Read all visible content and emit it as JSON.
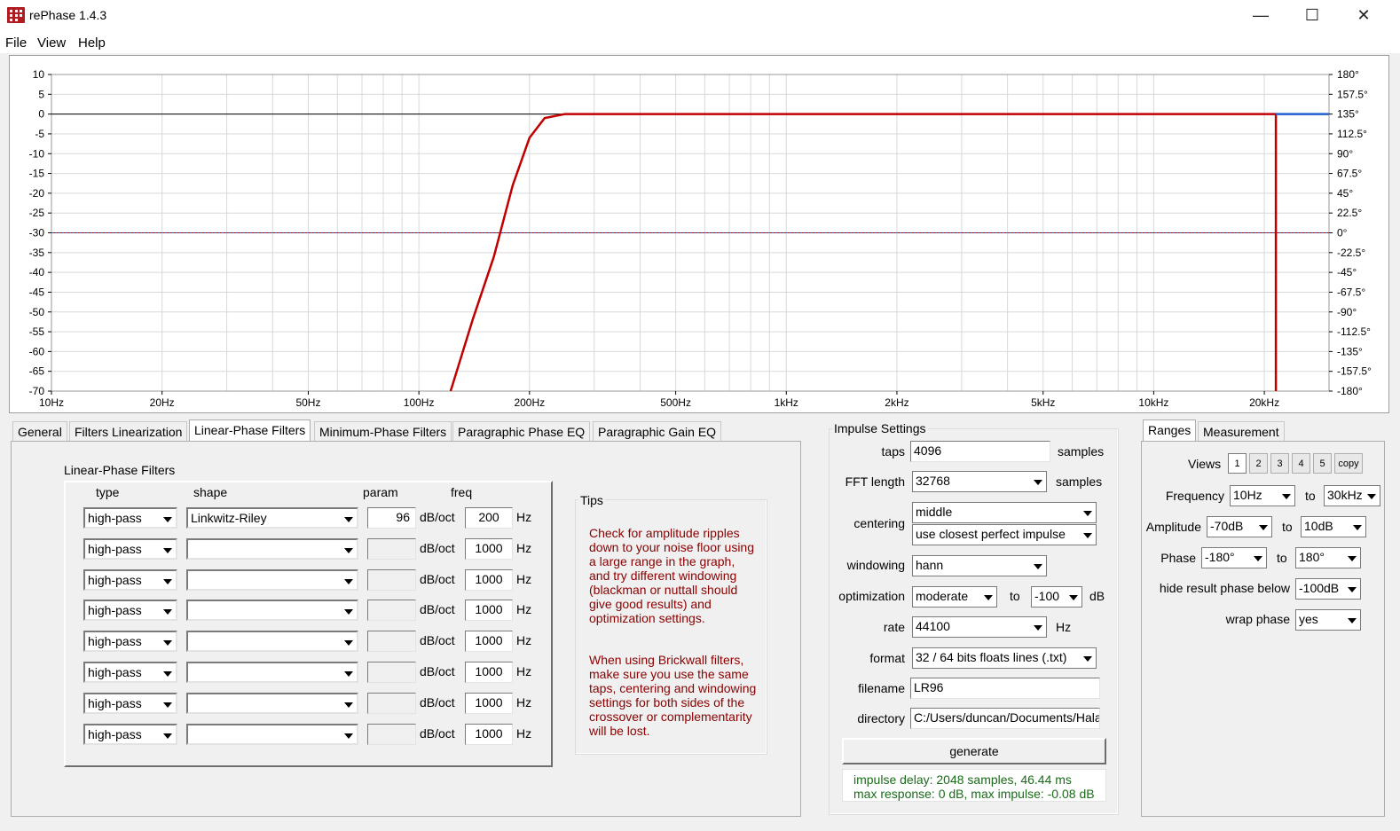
{
  "window": {
    "title": "rePhase 1.4.3",
    "minimize": "—",
    "maximize": "☐",
    "close": "✕"
  },
  "menu": [
    "File",
    "View",
    "Help"
  ],
  "graph": {
    "left_ticks": [
      "10",
      "5",
      "0",
      "-5",
      "-10",
      "-15",
      "-20",
      "-25",
      "-30",
      "-35",
      "-40",
      "-45",
      "-50",
      "-55",
      "-60",
      "-65",
      "-70"
    ],
    "right_ticks": [
      "180°",
      "157.5°",
      "135°",
      "112.5°",
      "90°",
      "67.5°",
      "45°",
      "22.5°",
      "0°",
      "-22.5°",
      "-45°",
      "-67.5°",
      "-90°",
      "-112.5°",
      "-135°",
      "-157.5°",
      "-180°"
    ],
    "x_ticks": [
      {
        "label": "10Hz",
        "f": 10
      },
      {
        "label": "20Hz",
        "f": 20
      },
      {
        "label": "50Hz",
        "f": 50
      },
      {
        "label": "100Hz",
        "f": 100
      },
      {
        "label": "200Hz",
        "f": 200
      },
      {
        "label": "500Hz",
        "f": 500
      },
      {
        "label": "1kHz",
        "f": 1000
      },
      {
        "label": "2kHz",
        "f": 2000
      },
      {
        "label": "5kHz",
        "f": 5000
      },
      {
        "label": "10kHz",
        "f": 10000
      },
      {
        "label": "20kHz",
        "f": 20000
      }
    ],
    "colors": {
      "magnitude": "#c00000",
      "phase": "#1f5fcf",
      "grid": "#d9d9d9"
    }
  },
  "chart_data": {
    "type": "line",
    "x_scale": "log",
    "xlim": [
      10,
      30000
    ],
    "ylim": [
      -70,
      10
    ],
    "y2lim": [
      -180,
      180
    ],
    "grid": true,
    "series": [
      {
        "axis": "left",
        "color": "#c00000",
        "x": [
          122,
          140,
          160,
          180,
          200,
          220,
          250,
          300,
          1000,
          10000,
          21500,
          21500
        ],
        "y": [
          -70,
          -52,
          -36,
          -18,
          -6,
          -1,
          0,
          0,
          0,
          0,
          0,
          -70
        ]
      },
      {
        "axis": "right",
        "color": "#1f5fcf",
        "x": [
          21500,
          30000
        ],
        "y": [
          135,
          135
        ]
      }
    ],
    "reference_lines": [
      {
        "axis": "left",
        "y": 0,
        "color": "#000000",
        "style": "solid"
      },
      {
        "axis": "left",
        "y": -30,
        "color": "#c00000",
        "style": "dotted"
      }
    ]
  },
  "tabs": [
    {
      "label": "General"
    },
    {
      "label": "Filters Linearization"
    },
    {
      "label": "Linear-Phase Filters",
      "active": true
    },
    {
      "label": "Minimum-Phase Filters"
    },
    {
      "label": "Paragraphic Phase EQ"
    },
    {
      "label": "Paragraphic Gain EQ"
    }
  ],
  "linear_phase": {
    "group_title": "Linear-Phase Filters",
    "headers": {
      "type": "type",
      "shape": "shape",
      "param": "param",
      "freq": "freq"
    },
    "unit_param": "dB/oct",
    "unit_freq": "Hz",
    "rows": [
      {
        "type": "high-pass",
        "shape": "Linkwitz-Riley",
        "param": "96",
        "freq": "200"
      },
      {
        "type": "high-pass",
        "shape": "",
        "param": "",
        "freq": "1000"
      },
      {
        "type": "high-pass",
        "shape": "",
        "param": "",
        "freq": "1000"
      },
      {
        "type": "high-pass",
        "shape": "",
        "param": "",
        "freq": "1000"
      },
      {
        "type": "high-pass",
        "shape": "",
        "param": "",
        "freq": "1000"
      },
      {
        "type": "high-pass",
        "shape": "",
        "param": "",
        "freq": "1000"
      },
      {
        "type": "high-pass",
        "shape": "",
        "param": "",
        "freq": "1000"
      },
      {
        "type": "high-pass",
        "shape": "",
        "param": "",
        "freq": "1000"
      }
    ]
  },
  "tips": {
    "title": "Tips",
    "text1": "Check for amplitude ripples down to your noise floor using a large range in the graph, and try different windowing (blackman or nuttall should give good results) and optimization settings.",
    "text2": "When using Brickwall filters, make sure you use the same taps, centering and windowing settings for both sides of the crossover or complementarity will be lost."
  },
  "impulse": {
    "title": "Impulse Settings",
    "taps_label": "taps",
    "taps": "4096",
    "taps_unit": "samples",
    "fft_label": "FFT length",
    "fft": "32768",
    "fft_unit": "samples",
    "centering_label": "centering",
    "centering": "middle",
    "centering2": "use closest perfect impulse",
    "windowing_label": "windowing",
    "windowing": "hann",
    "optimization_label": "optimization",
    "optimization": "moderate",
    "opt_to": "to",
    "opt_db": "-100",
    "opt_unit": "dB",
    "rate_label": "rate",
    "rate": "44100",
    "rate_unit": "Hz",
    "format_label": "format",
    "format": "32 / 64 bits floats lines (.txt)",
    "filename_label": "filename",
    "filename": "LR96",
    "directory_label": "directory",
    "directory": "C:/Users/duncan/Documents/Hala",
    "generate": "generate",
    "status1": "impulse delay: 2048 samples, 46.44 ms",
    "status2": "max response: 0 dB, max impulse: -0.08 dB"
  },
  "ranges": {
    "tabs": [
      {
        "label": "Ranges",
        "active": true
      },
      {
        "label": "Measurement"
      }
    ],
    "views_label": "Views",
    "views": [
      "1",
      "2",
      "3",
      "4",
      "5"
    ],
    "copy": "copy",
    "frequency_label": "Frequency",
    "freq_from": "10Hz",
    "freq_to": "30kHz",
    "amplitude_label": "Amplitude",
    "amp_from": "-70dB",
    "amp_to": "10dB",
    "phase_label": "Phase",
    "phase_from": "-180°",
    "phase_to": "180°",
    "to": "to",
    "hide_label": "hide result phase below",
    "hide": "-100dB",
    "wrap_label": "wrap phase",
    "wrap": "yes"
  }
}
